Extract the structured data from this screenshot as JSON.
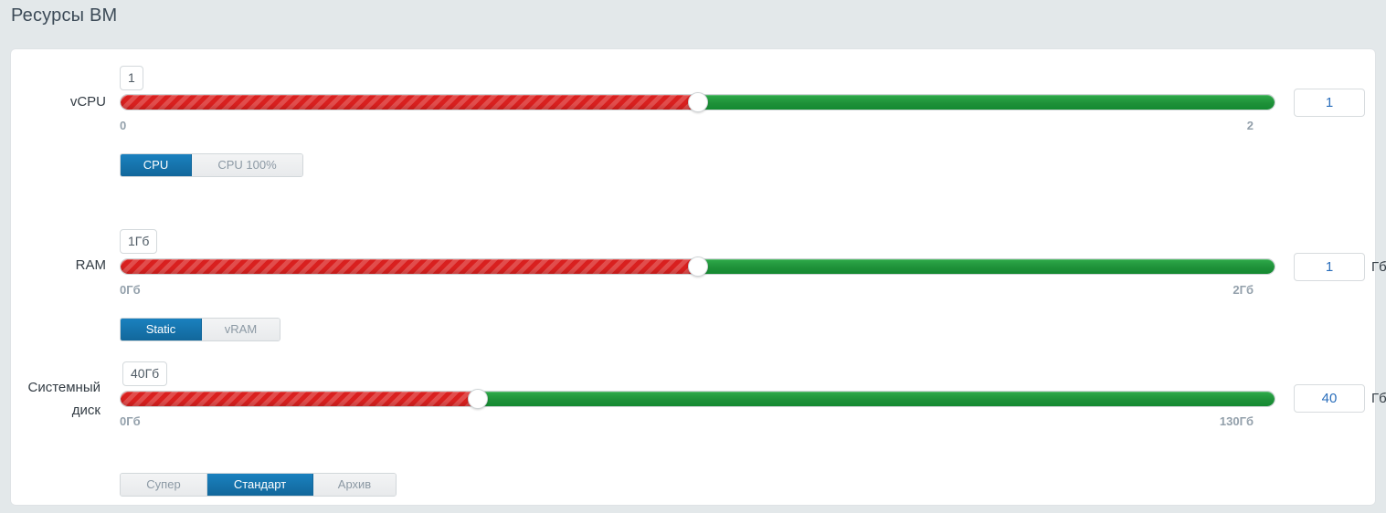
{
  "page": {
    "title": "Ресурсы ВМ"
  },
  "theme": {
    "background": "#e3e8ea",
    "panel_background": "#ffffff",
    "accent_active": "#1a81bf",
    "slider_used": "#d9201f",
    "slider_free": "#1f9139",
    "input_text": "#2a6ebb",
    "tick_text": "#93a0ab"
  },
  "rows": [
    {
      "key": "vcpu",
      "label": "vCPU",
      "tooltip": "1",
      "min_label": "0",
      "max_label": "2",
      "value": "1",
      "unit": "",
      "min": 0,
      "max": 2,
      "percent": 50,
      "modes": [
        {
          "label": "CPU",
          "active": true
        },
        {
          "label": "CPU 100%",
          "active": false
        }
      ]
    },
    {
      "key": "ram",
      "label": "RAM",
      "tooltip": "1Гб",
      "min_label": "0Гб",
      "max_label": "2Гб",
      "value": "1",
      "unit": "Гб",
      "min": 0,
      "max": 2,
      "percent": 50,
      "modes": [
        {
          "label": "Static",
          "active": true
        },
        {
          "label": "vRAM",
          "active": false
        }
      ]
    },
    {
      "key": "system-disk",
      "label": "Системный диск",
      "tooltip": "40Гб",
      "min_label": "0Гб",
      "max_label": "130Гб",
      "value": "40",
      "unit": "Гб",
      "min": 0,
      "max": 130,
      "percent": 31,
      "modes": [
        {
          "label": "Супер",
          "active": false
        },
        {
          "label": "Стандарт",
          "active": true
        },
        {
          "label": "Архив",
          "active": false
        }
      ]
    }
  ]
}
